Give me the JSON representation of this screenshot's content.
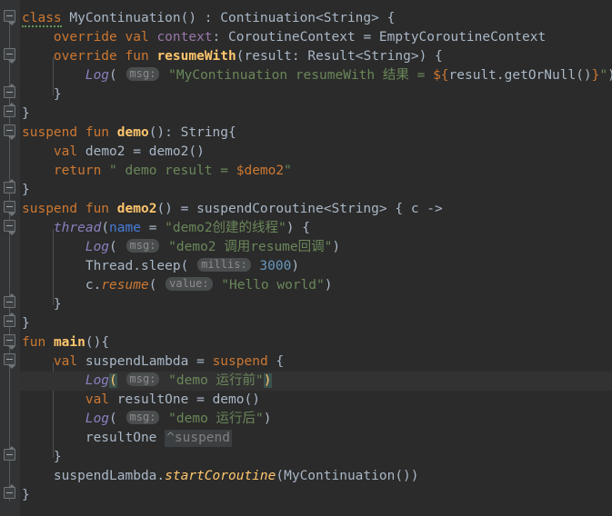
{
  "editor": {
    "language": "Kotlin",
    "theme": "Darcula",
    "background_color": "#2b2b2b",
    "gutter_color": "#313335",
    "caret_line_color": "#323232",
    "caret_line_number": 18,
    "line_height": 21,
    "total_lines": 24
  },
  "palette": {
    "keyword": "#cc7832",
    "function_declaration": "#ffc66d",
    "string": "#6a8759",
    "number": "#6897bb",
    "identifier": "#a9b7c6",
    "named_argument": "#467cda",
    "inlay_hint_bg": "#4a4d4e",
    "inlay_hint_fg": "#8c8c8c",
    "brace_match_bg": "#3b514d",
    "indent_guide": "#4b5052"
  },
  "code": {
    "lines": [
      {
        "n": 1,
        "fold": "down",
        "text": "class MyContinuation() : Continuation<String> {"
      },
      {
        "n": 2,
        "fold": "",
        "text": "    override val context: CoroutineContext = EmptyCoroutineContext"
      },
      {
        "n": 3,
        "fold": "down",
        "text": "    override fun resumeWith(result: Result<String>) {"
      },
      {
        "n": 4,
        "fold": "",
        "text": "        Log( msg: \"MyContinuation resumeWith 结果 = ${result.getOrNull()}\")"
      },
      {
        "n": 5,
        "fold": "up",
        "text": "    }"
      },
      {
        "n": 6,
        "fold": "up",
        "text": "}"
      },
      {
        "n": 7,
        "fold": "down",
        "text": "suspend fun demo(): String{"
      },
      {
        "n": 8,
        "fold": "",
        "text": "    val demo2 = demo2()"
      },
      {
        "n": 9,
        "fold": "",
        "text": "    return \" demo result = $demo2\""
      },
      {
        "n": 10,
        "fold": "up",
        "text": "}"
      },
      {
        "n": 11,
        "fold": "down",
        "text": "suspend fun demo2() = suspendCoroutine<String> { c ->"
      },
      {
        "n": 12,
        "fold": "down",
        "text": "    thread(name = \"demo2创建的线程\") {"
      },
      {
        "n": 13,
        "fold": "",
        "text": "        Log( msg: \"demo2 调用resume回调\")"
      },
      {
        "n": 14,
        "fold": "",
        "text": "        Thread.sleep( millis: 3000)"
      },
      {
        "n": 15,
        "fold": "",
        "text": "        c.resume( value: \"Hello world\")"
      },
      {
        "n": 16,
        "fold": "up",
        "text": "    }"
      },
      {
        "n": 17,
        "fold": "up",
        "text": "}"
      },
      {
        "n": 18,
        "fold": "down",
        "text": "fun main(){"
      },
      {
        "n": 19,
        "fold": "down",
        "text": "    val suspendLambda = suspend {"
      },
      {
        "n": 20,
        "fold": "",
        "text": "        Log( msg: \"demo 运行前\")"
      },
      {
        "n": 21,
        "fold": "",
        "text": "        val resultOne = demo()"
      },
      {
        "n": 22,
        "fold": "",
        "text": "        Log( msg: \"demo 运行后\")"
      },
      {
        "n": 23,
        "fold": "",
        "text": "        resultOne ^suspend"
      },
      {
        "n": 24,
        "fold": "up",
        "text": "    }"
      },
      {
        "n": 25,
        "fold": "",
        "text": "    suspendLambda.startCoroutine(MyContinuation())"
      },
      {
        "n": 26,
        "fold": "up",
        "text": "}"
      }
    ],
    "inlay_hints": [
      "msg:",
      "msg:",
      "millis:",
      "value:",
      "msg:",
      "msg:"
    ],
    "inline_labels": [
      "^suspend"
    ],
    "keywords": [
      "class",
      "override",
      "val",
      "fun",
      "suspend",
      "return"
    ],
    "types": [
      "Continuation",
      "String",
      "CoroutineContext",
      "EmptyCoroutineContext",
      "Result",
      "Thread"
    ],
    "strings": [
      "\"MyContinuation resumeWith 结果 = ${result.getOrNull()}\"",
      "\" demo result = $demo2\"",
      "\"demo2创建的线程\"",
      "\"demo2 调用resume回调\"",
      "\"Hello world\"",
      "\"demo 运行前\"",
      "\"demo 运行后\""
    ],
    "numbers": [
      "3000"
    ],
    "functions": [
      "MyContinuation",
      "resumeWith",
      "demo",
      "demo2",
      "main",
      "Log",
      "thread",
      "sleep",
      "resume",
      "suspendCoroutine",
      "startCoroutine",
      "getOrNull"
    ]
  }
}
